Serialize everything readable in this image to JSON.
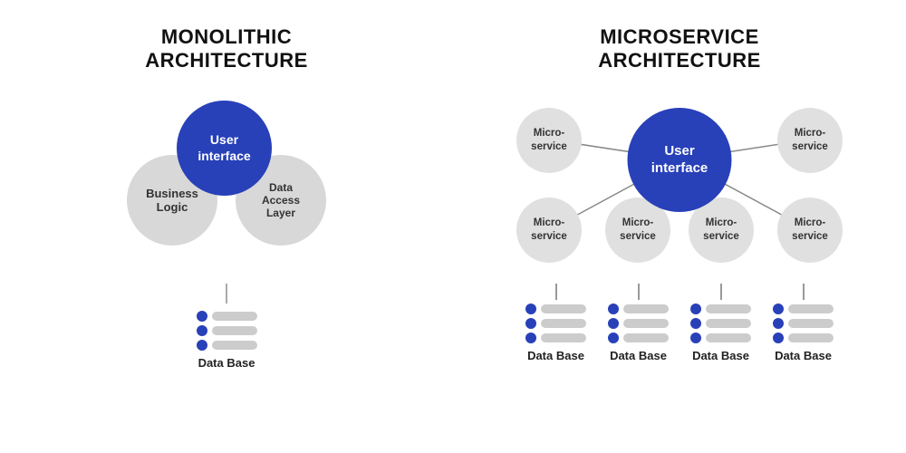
{
  "monolithic": {
    "title": "MONOLITHIC\nARCHITECTURE",
    "ui_label": "User\ninterface",
    "bl_label": "Business\nLogic",
    "dal_label": "Data\nAccess\nLayer",
    "db_label": "Data Base"
  },
  "microservice": {
    "title": "MICROSERVICE\nARCHITECTURE",
    "ui_label": "User\ninterface",
    "micro_labels": [
      "Micro-\nservice",
      "Micro-\nservice",
      "Micro-\nservice",
      "Micro-\nservice",
      "Micro-\nservice",
      "Micro-\nservice"
    ],
    "db_label": "Data Base"
  }
}
